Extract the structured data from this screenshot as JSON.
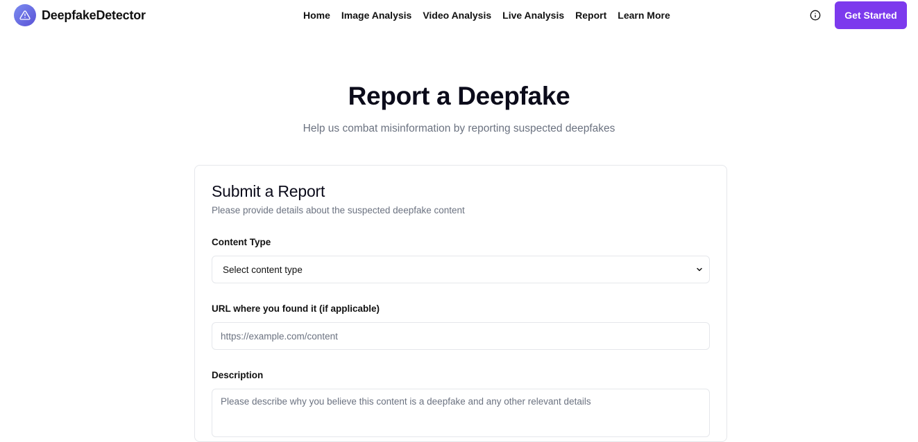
{
  "brand": {
    "name": "DeepfakeDetector",
    "logo_icon": "warning-triangle-icon",
    "logo_gradient": [
      "#7b8cf0",
      "#5a52d6"
    ]
  },
  "nav": {
    "links": [
      "Home",
      "Image Analysis",
      "Video Analysis",
      "Live Analysis",
      "Report",
      "Learn More"
    ]
  },
  "header": {
    "info_icon": "info-circle-icon",
    "cta_label": "Get Started",
    "cta_color": "#7c3aed"
  },
  "hero": {
    "title": "Report a Deepfake",
    "subtitle": "Help us combat misinformation by reporting suspected deepfakes"
  },
  "form": {
    "title": "Submit a Report",
    "description": "Please provide details about the suspected deepfake content",
    "content_type": {
      "label": "Content Type",
      "selected": "Select content type",
      "icon": "chevron-down-icon"
    },
    "url": {
      "label": "URL where you found it (if applicable)",
      "placeholder": "https://example.com/content",
      "value": ""
    },
    "description_field": {
      "label": "Description",
      "placeholder": "Please describe why you believe this content is a deepfake and any other relevant details",
      "value": ""
    }
  }
}
